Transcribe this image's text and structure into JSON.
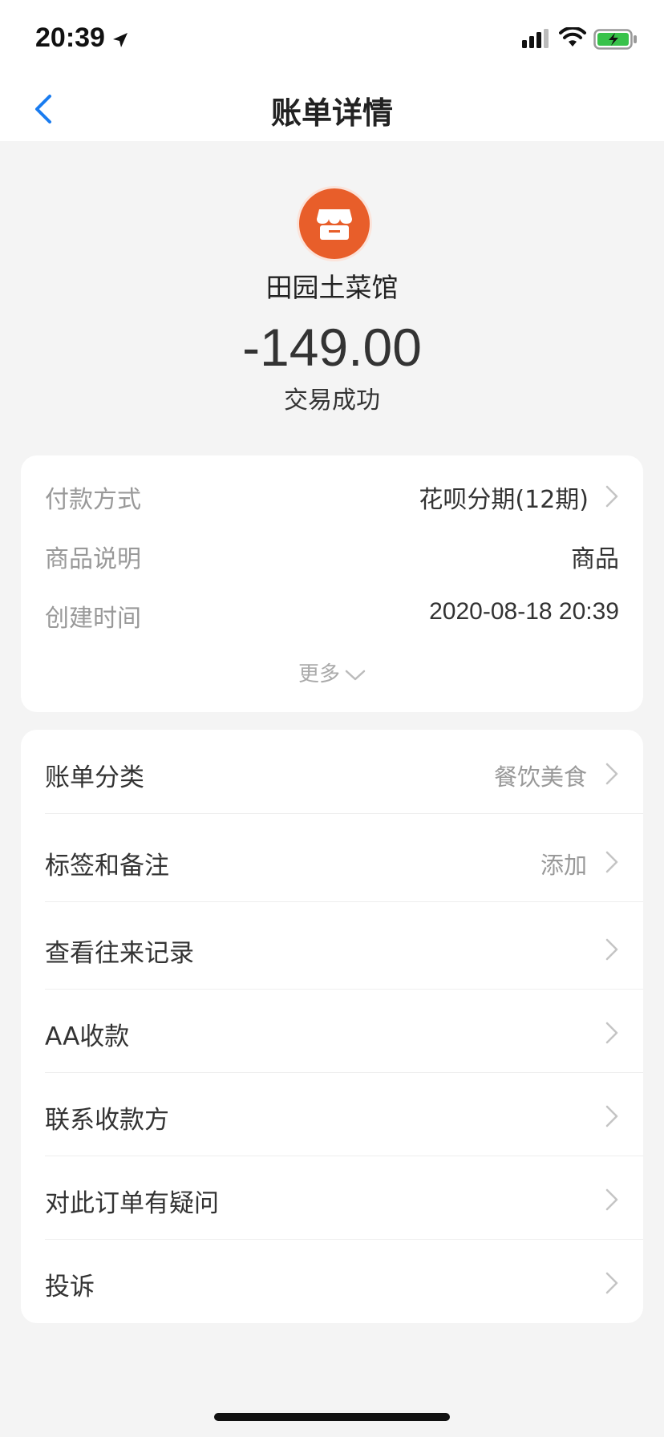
{
  "status_bar": {
    "time": "20:39"
  },
  "nav": {
    "title": "账单详情"
  },
  "merchant": {
    "name": "田园土菜馆",
    "logo_color": "#e85e2a"
  },
  "transaction": {
    "amount": "-149.00",
    "status": "交易成功"
  },
  "details": {
    "rows": [
      {
        "label": "付款方式",
        "value": "花呗分期(12期)"
      },
      {
        "label": "商品说明",
        "value": "商品"
      },
      {
        "label": "创建时间",
        "value": "2020-08-18 20:39"
      }
    ],
    "more_label": "更多"
  },
  "menu": {
    "items": [
      {
        "label": "账单分类",
        "value": "餐饮美食"
      },
      {
        "label": "标签和备注",
        "value": "添加"
      },
      {
        "label": "查看往来记录"
      },
      {
        "label": "AA收款"
      },
      {
        "label": "联系收款方"
      },
      {
        "label": "对此订单有疑问"
      },
      {
        "label": "投诉"
      }
    ]
  },
  "colors": {
    "accent": "#1a7cf0",
    "background": "#f4f4f4"
  }
}
